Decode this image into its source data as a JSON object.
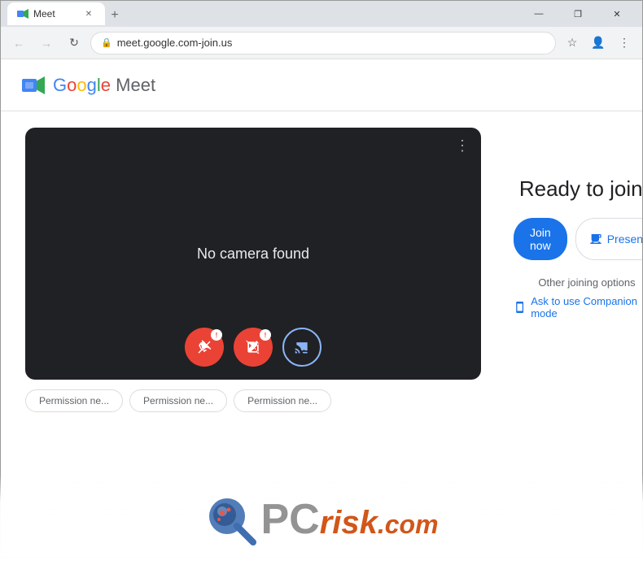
{
  "browser": {
    "tab_title": "Meet",
    "tab_favicon": "📹",
    "url": "meet.google.com-join.us",
    "new_tab_label": "+",
    "minimize_label": "—",
    "maximize_label": "❐",
    "close_label": "✕",
    "back_label": "←",
    "forward_label": "→",
    "refresh_label": "↻"
  },
  "meet": {
    "logo_brand": "Google Meet",
    "logo_google": "Google",
    "logo_meet": "Meet",
    "no_camera_text": "No camera found",
    "dots_menu": "⋮",
    "ready_title": "Ready to join?",
    "join_now_label": "Join now",
    "present_label": "Present",
    "present_icon": "⬡",
    "other_options_label": "Other joining options",
    "companion_icon": "⊡",
    "companion_label": "Ask to use Companion mode"
  },
  "permissions": {
    "pill1": "Permission ne...",
    "pill2": "Permission ne...",
    "pill3": "Permission ne..."
  },
  "watermark": {
    "pc_text": "PC",
    "risk_text": "risk",
    "dotcom_text": ".com"
  }
}
